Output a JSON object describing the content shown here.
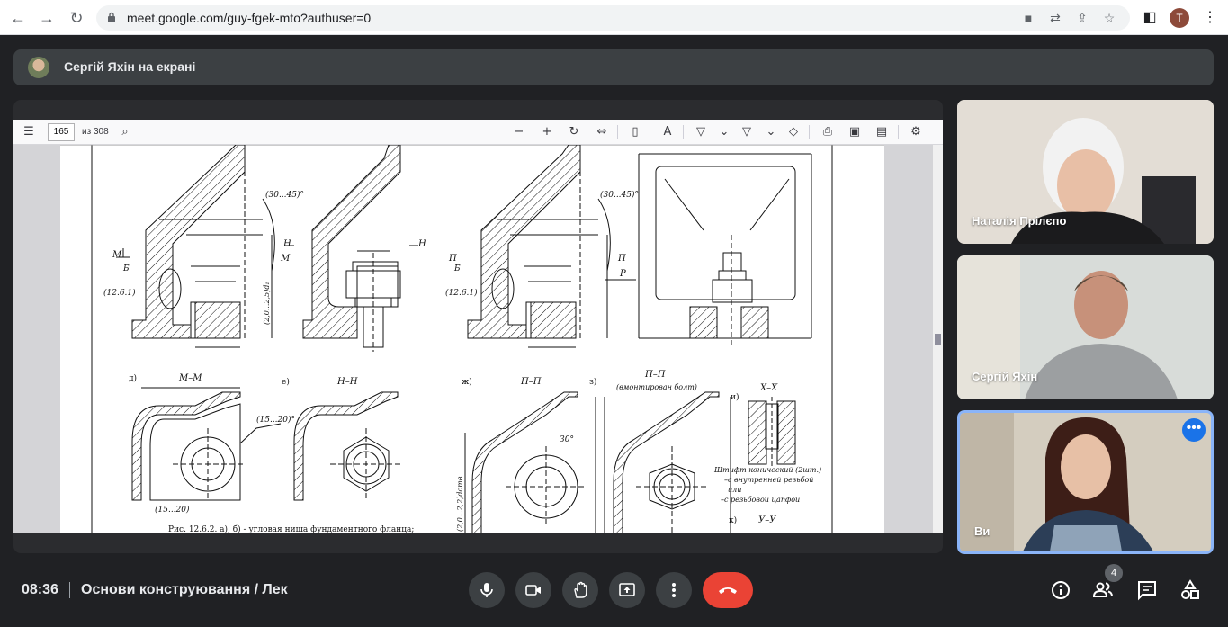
{
  "browser": {
    "url": "meet.google.com/guy-fgek-mto?authuser=0",
    "profile_initial": "T"
  },
  "banner": {
    "presenting_text": "Сергій Яхін на екрані"
  },
  "pdf_viewer": {
    "page_number": "165",
    "page_total": "из 308"
  },
  "drawing": {
    "label_d": "д)",
    "label_e": "е)",
    "label_zh": "ж)",
    "label_z": "з)",
    "label_i": "и)",
    "label_k": "к)",
    "section_mm": "М–М",
    "section_nn": "Н–Н",
    "section_pp": "П–П",
    "section_pp2": "П–П",
    "section_pp2_note": "(вмонтирован болт)",
    "section_xx": "Х–Х",
    "section_yy": "У–У",
    "angle_1": "(30...45)°",
    "angle_2": "(30...45)°",
    "angle_3": "(15...20)°",
    "angle_4": "30°",
    "dim_15_20": "(15...20)",
    "dim_2_25": "(2,0...2,5)d₁",
    "dim_2_22": "(2,0...2,2)dотв",
    "ref_b": "Б",
    "ref_1261": "(12.6.1)",
    "ref_b2": "Б",
    "ref_1261_2": "(12.6.1)",
    "mark_m1": "М",
    "mark_m2": "М",
    "mark_n1": "Н",
    "mark_n2": "Н",
    "mark_p1": "П",
    "mark_p2": "П",
    "mark_pp": "Р",
    "pin_note_1": "Штифт конический (2шт.)",
    "pin_note_2": "–с внутренней резьбой",
    "pin_note_3": "или",
    "pin_note_4": "–с резьбовой цапфой",
    "caption": "Рис. 12.6.2. а), б) - угловая ниша фундаментного фланца;"
  },
  "participants": [
    {
      "name": "Наталія Прілєпо"
    },
    {
      "name": "Сергій Яхін"
    },
    {
      "name": "Ви"
    }
  ],
  "bottom_bar": {
    "time": "08:36",
    "meeting_title": "Основи конструювання / Лек",
    "participants_count": "4"
  },
  "colors": {
    "background": "#202124",
    "hangup": "#ea4335",
    "self_border": "#8ab4f8",
    "accent": "#1a73e8"
  }
}
